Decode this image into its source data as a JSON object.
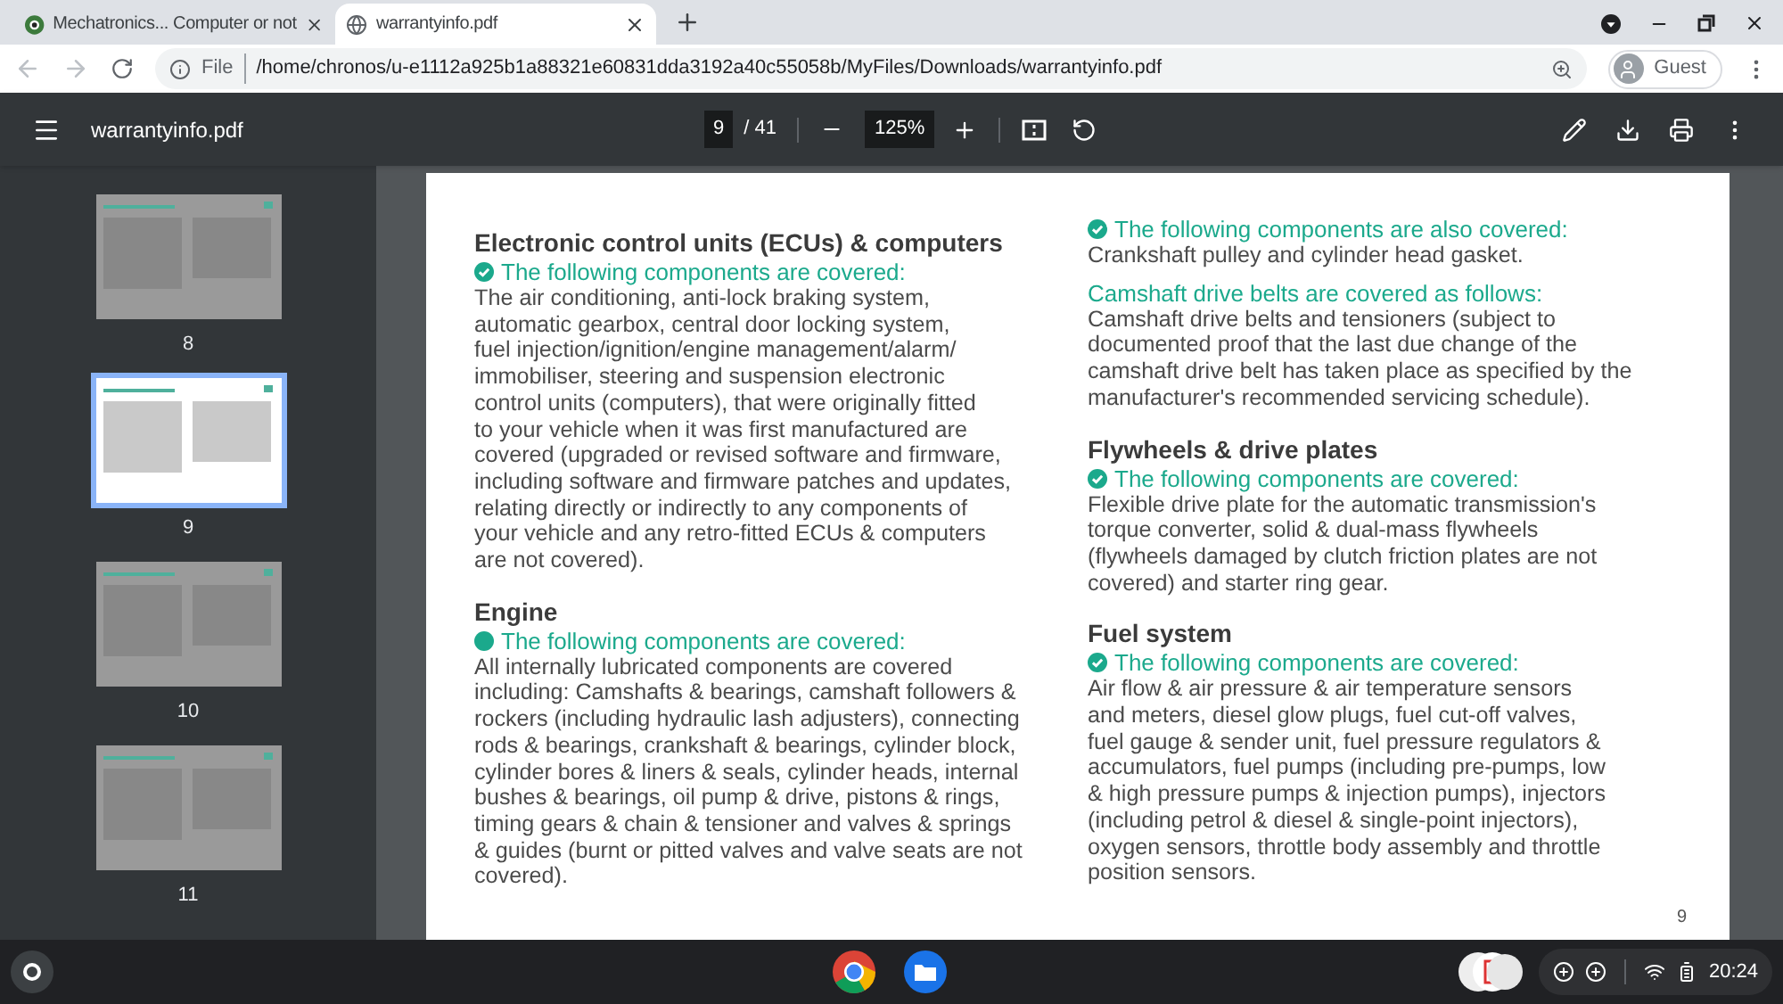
{
  "browser_tabs": [
    {
      "title": "Mechatronics... Computer or not",
      "selected": false
    },
    {
      "title": "warrantyinfo.pdf",
      "selected": true
    }
  ],
  "address_bar": {
    "scheme": "File",
    "url": "/home/chronos/u-e1112a925b1a88321e60831dda3192a40c55058b/MyFiles/Downloads/warrantyinfo.pdf"
  },
  "profile": {
    "label": "Guest"
  },
  "pdf_toolbar": {
    "title": "warrantyinfo.pdf",
    "page": "9",
    "page_total": "/ 41",
    "zoom": "125%"
  },
  "thumbnails": [
    {
      "label": "8",
      "selected": false
    },
    {
      "label": "9",
      "selected": true
    },
    {
      "label": "10",
      "selected": false
    },
    {
      "label": "11",
      "selected": false
    }
  ],
  "page": {
    "columns": [
      [
        {
          "kind": "heading",
          "text": "Electronic control units (ECUs) & computers"
        },
        {
          "kind": "check_line",
          "text": "The following components are covered:"
        },
        {
          "kind": "body",
          "text": "The air conditioning, anti-lock braking system,\nautomatic gearbox, central door locking system,\nfuel injection/ignition/engine management/alarm/\nimmobiliser, steering and suspension electronic\ncontrol units (computers), that were originally fitted\nto your vehicle when it was first manufactured are\ncovered (upgraded or revised software and firmware,\nincluding software and firmware patches and updates,\nrelating directly or indirectly to any components of\nyour vehicle and any retro-fitted ECUs & computers\nare not covered)."
        },
        {
          "kind": "heading",
          "text": "Engine"
        },
        {
          "kind": "dot_line",
          "text": "The following components are covered:"
        },
        {
          "kind": "body",
          "text": "All internally lubricated components are covered\nincluding: Camshafts & bearings, camshaft followers &\nrockers (including hydraulic lash adjusters), connecting\nrods & bearings, crankshaft & bearings, cylinder block,\ncylinder bores & liners & seals, cylinder heads, internal\nbushes & bearings, oil pump & drive, pistons & rings,\ntiming gears & chain & tensioner and valves & springs\n& guides (burnt or pitted valves and valve seats are not\ncovered)."
        }
      ],
      [
        {
          "kind": "check_line",
          "text": "The following components are also covered:"
        },
        {
          "kind": "body",
          "text": "Crankshaft pulley and cylinder head gasket."
        },
        {
          "kind": "plain_line",
          "text": "Camshaft drive belts are covered as follows:"
        },
        {
          "kind": "body",
          "text": "Camshaft drive belts and tensioners (subject to\ndocumented proof that the last due change of  the\ncamshaft drive belt has taken place as specified by the\nmanufacturer's recommended servicing schedule)."
        },
        {
          "kind": "heading",
          "text": "Flywheels & drive plates"
        },
        {
          "kind": "check_line",
          "text": "The following components are covered:"
        },
        {
          "kind": "body",
          "text": "Flexible drive plate for the automatic transmission's\ntorque converter, solid & dual-mass flywheels\n(flywheels damaged by clutch friction plates are not\ncovered) and starter ring gear."
        },
        {
          "kind": "heading",
          "text": "Fuel system"
        },
        {
          "kind": "check_line",
          "text": "The following components are covered:"
        },
        {
          "kind": "body",
          "text": "Air flow & air pressure & air temperature sensors\nand meters, diesel glow plugs, fuel cut-off valves,\nfuel gauge & sender unit, fuel pressure regulators &\naccumulators, fuel pumps (including pre-pumps, low\n& high pressure pumps & injection pumps), injectors\n(including petrol & diesel & single-point injectors),\noxygen sensors, throttle body assembly and throttle\nposition sensors."
        }
      ]
    ],
    "page_number": "9"
  },
  "shelf": {
    "time": "20:24"
  }
}
